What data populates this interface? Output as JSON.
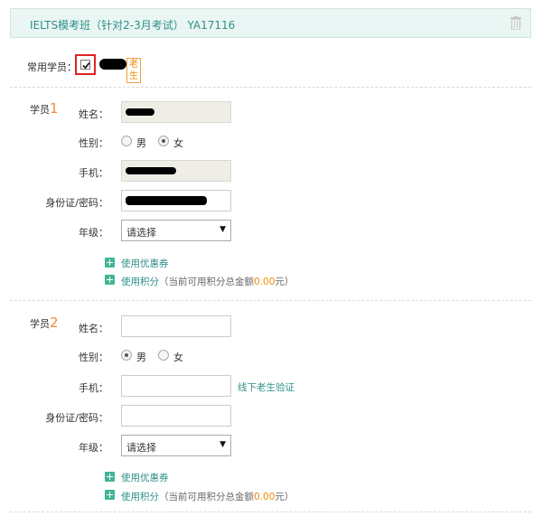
{
  "header": {
    "title": "IELTS模考班（针对2-3月考试）  YA17116",
    "delete_icon": "trash-icon"
  },
  "common": {
    "label": "常用学员：",
    "checked": true,
    "tag": "老生"
  },
  "students": [
    {
      "prefix": "学员",
      "num": "1",
      "fields": {
        "name_label": "姓名：",
        "gender_label": "性别：",
        "gender_male": "男",
        "gender_female": "女",
        "gender_selected": "女",
        "phone_label": "手机：",
        "id_label": "身份证/密码：",
        "grade_label": "年级：",
        "grade_value": "请选择"
      },
      "coupon": "使用优惠券",
      "points_link": "使用积分",
      "points_hint_pre": "（当前可用积分总金额",
      "points_amount": "0.00",
      "points_hint_post": "元）"
    },
    {
      "prefix": "学员",
      "num": "2",
      "fields": {
        "name_label": "姓名：",
        "gender_label": "性别：",
        "gender_male": "男",
        "gender_female": "女",
        "gender_selected": "男",
        "phone_label": "手机：",
        "verify_link": "线下老生验证",
        "id_label": "身份证/密码：",
        "grade_label": "年级：",
        "grade_value": "请选择"
      },
      "coupon": "使用优惠券",
      "points_link": "使用积分",
      "points_hint_pre": "（当前可用积分总金额",
      "points_amount": "0.00",
      "points_hint_post": "元）"
    }
  ]
}
